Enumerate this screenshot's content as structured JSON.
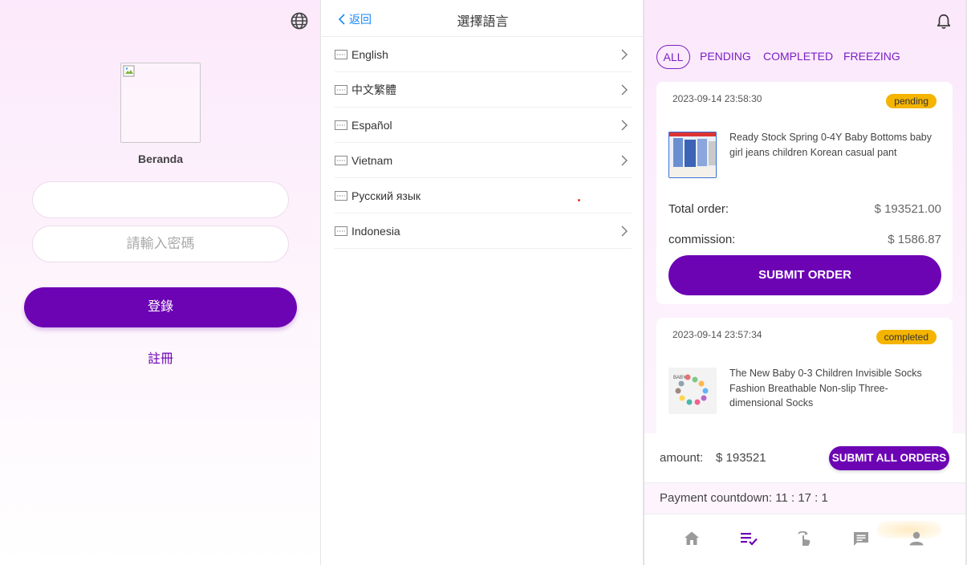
{
  "login": {
    "brand": "Beranda",
    "username_placeholder": "",
    "password_placeholder": "請輸入密碼",
    "login_label": "登錄",
    "register_label": "註冊",
    "globe_icon": "globe-icon"
  },
  "language": {
    "back_label": "返回",
    "title": "選擇語言",
    "items": [
      {
        "label": "English"
      },
      {
        "label": "中文繁體"
      },
      {
        "label": "Español"
      },
      {
        "label": "Vietnam"
      },
      {
        "label": "Русский язык"
      },
      {
        "label": "Indonesia"
      }
    ]
  },
  "orders": {
    "tabs": [
      {
        "label": "ALL"
      },
      {
        "label": "PENDING"
      },
      {
        "label": "COMPLETED"
      },
      {
        "label": "FREEZING"
      }
    ],
    "cards": [
      {
        "time": "2023-09-14 23:58:30",
        "status": "pending",
        "title": "Ready Stock Spring 0-4Y Baby Bottoms baby girl jeans children Korean casual pant",
        "total_label": "Total order:",
        "total_value": "$ 193521.00",
        "commission_label": "commission:",
        "commission_value": "$ 1586.87",
        "submit_label": "SUBMIT ORDER"
      },
      {
        "time": "2023-09-14 23:57:34",
        "status": "completed",
        "title": "The New Baby 0-3 Children Invisible Socks Fashion Breathable Non-slip Three-dimensional Socks"
      }
    ],
    "amount_label": "amount:",
    "amount_value": "$ 193521",
    "submit_all_label": "SUBMIT ALL ORDERS",
    "countdown": "Payment countdown: 11 : 17 : 1",
    "status_color": "#f4b400",
    "accent_color": "#6c04b4",
    "tabbar": [
      "home-icon",
      "orders-icon",
      "task-icon",
      "chat-icon",
      "user-icon"
    ]
  }
}
